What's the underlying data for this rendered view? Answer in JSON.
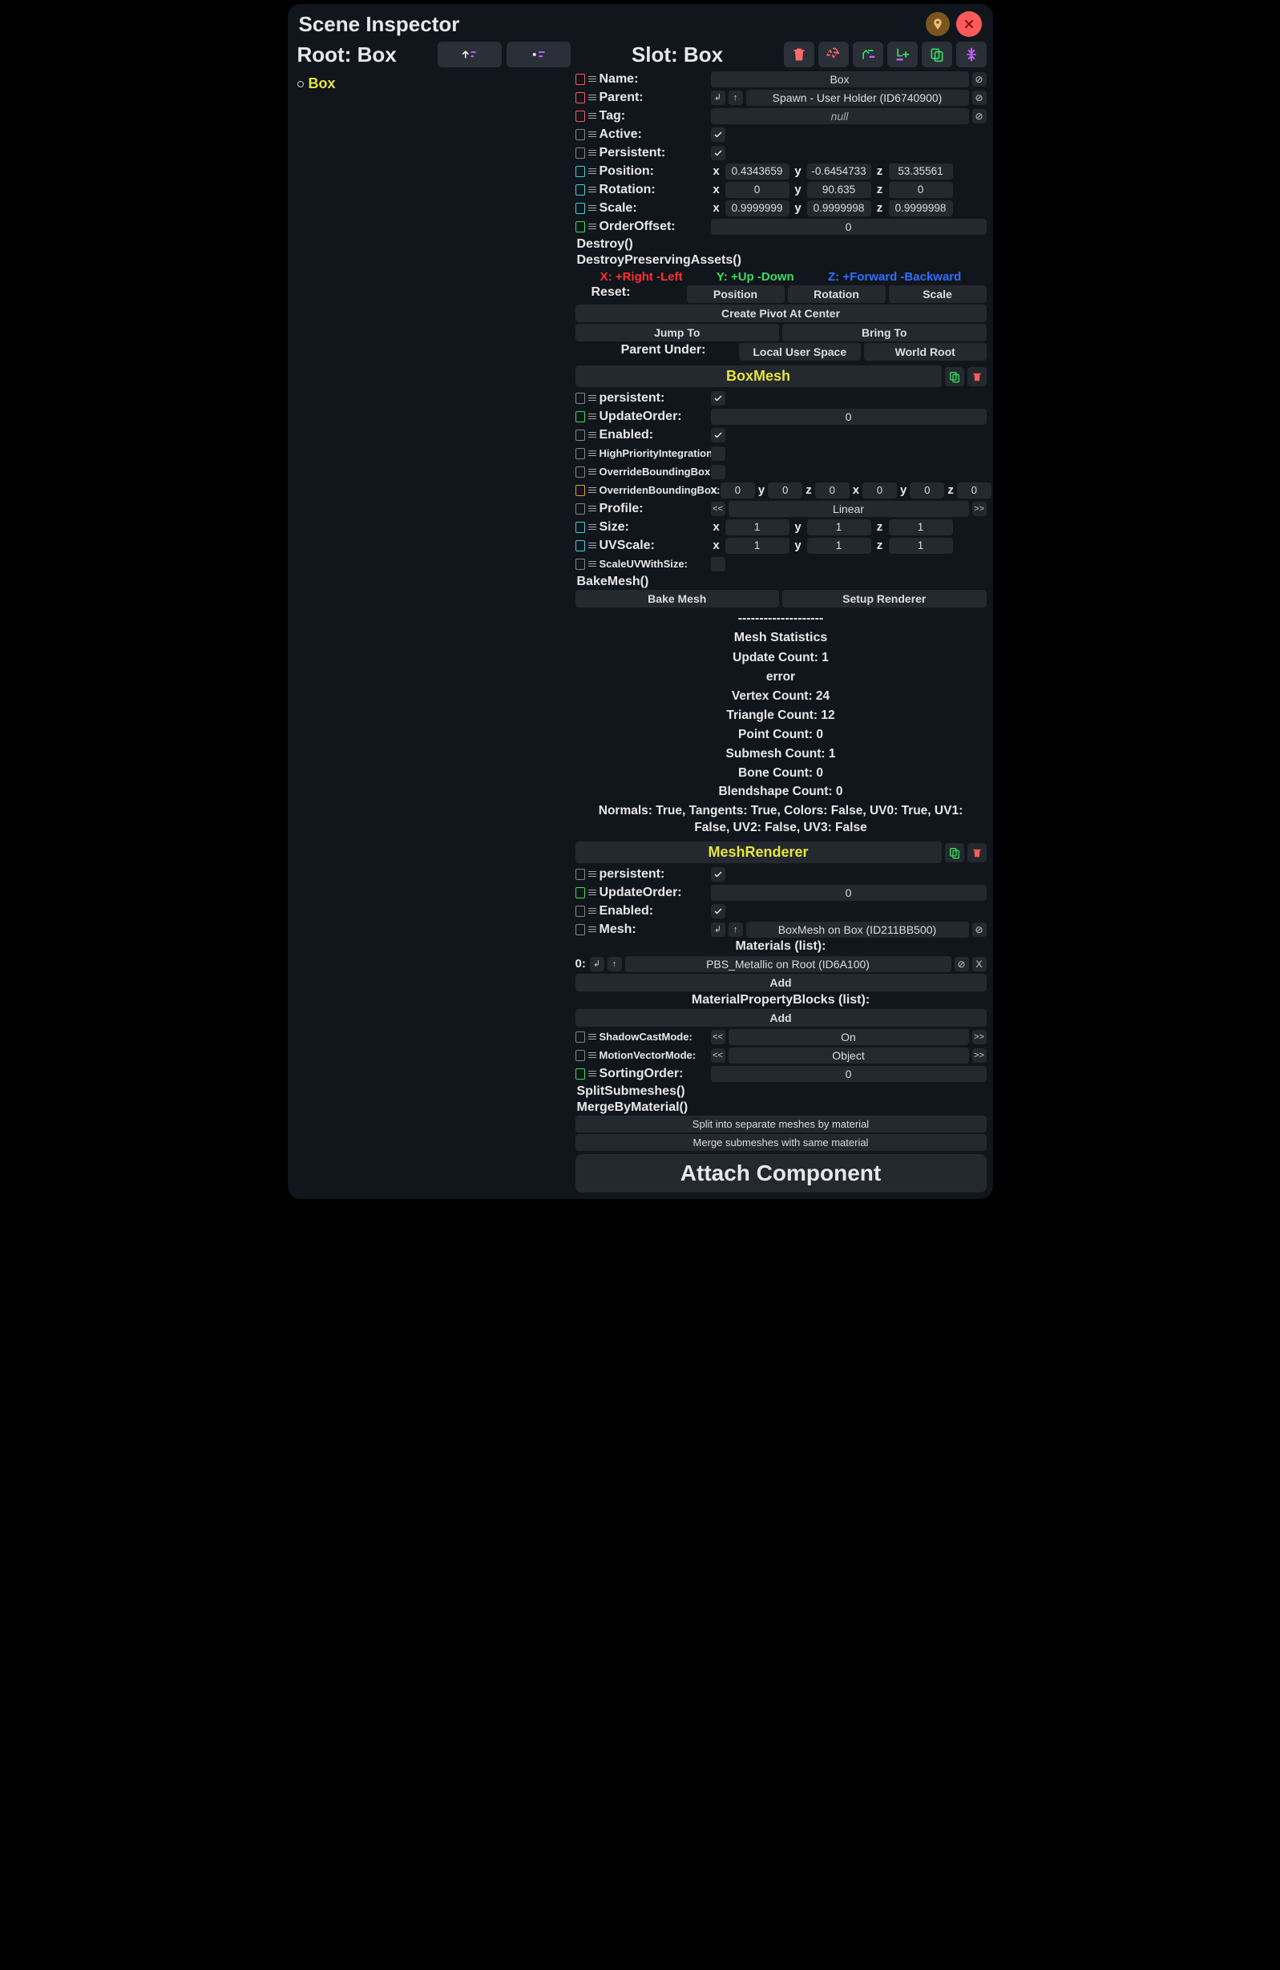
{
  "title": "Scene Inspector",
  "root": {
    "label": "Root: Box",
    "tree_item": "Box"
  },
  "slot": {
    "title": "Slot: Box"
  },
  "fields": {
    "name": {
      "label": "Name:",
      "value": "Box"
    },
    "parent": {
      "label": "Parent:",
      "value": "Spawn - User Holder (ID6740900)"
    },
    "tag": {
      "label": "Tag:",
      "value": "null"
    },
    "active": {
      "label": "Active:",
      "checked": true
    },
    "persistent": {
      "label": "Persistent:",
      "checked": true
    },
    "position": {
      "label": "Position:",
      "x": "0.4343659",
      "y": "-0.6454733",
      "z": "53.35561"
    },
    "rotation": {
      "label": "Rotation:",
      "x": "0",
      "y": "90.635",
      "z": "0"
    },
    "scale": {
      "label": "Scale:",
      "x": "0.9999999",
      "y": "0.9999998",
      "z": "0.9999998"
    },
    "orderoffset": {
      "label": "OrderOffset:",
      "value": "0"
    }
  },
  "funcs": {
    "destroy": "Destroy()",
    "destroypa": "DestroyPreservingAssets()"
  },
  "axishint": {
    "x": "X: +Right -Left",
    "y": "Y: +Up -Down",
    "z": "Z: +Forward -Backward"
  },
  "reset": {
    "label": "Reset:",
    "pos": "Position",
    "rot": "Rotation",
    "scl": "Scale"
  },
  "createpivot": "Create Pivot At Center",
  "jumpto": "Jump To",
  "bringto": "Bring To",
  "parentunder": {
    "label": "Parent Under:",
    "local": "Local User Space",
    "world": "World Root"
  },
  "boxmesh": {
    "title": "BoxMesh",
    "persistent": {
      "label": "persistent:",
      "checked": true
    },
    "updateorder": {
      "label": "UpdateOrder:",
      "value": "0"
    },
    "enabled": {
      "label": "Enabled:",
      "checked": true
    },
    "hpi": {
      "label": "HighPriorityIntegration:"
    },
    "obb": {
      "label": "OverrideBoundingBox:"
    },
    "obbb": {
      "label": "OverridenBoundingBox:",
      "x1": "0",
      "y1": "0",
      "z1": "0",
      "x2": "0",
      "y2": "0",
      "z2": "0"
    },
    "profile": {
      "label": "Profile:",
      "value": "Linear"
    },
    "size": {
      "label": "Size:",
      "x": "1",
      "y": "1",
      "z": "1"
    },
    "uvscale": {
      "label": "UVScale:",
      "x": "1",
      "y": "1",
      "z": "1"
    },
    "scaleuv": {
      "label": "ScaleUVWithSize:"
    },
    "bakefn": "BakeMesh()",
    "bakebtn": "Bake Mesh",
    "setuprend": "Setup Renderer",
    "divider": "--------------------",
    "stats_h": "Mesh Statistics",
    "updcnt": "Update Count: 1",
    "err": "error",
    "vcnt": "Vertex Count: 24",
    "tcnt": "Triangle Count: 12",
    "pcnt": "Point Count: 0",
    "scnt": "Submesh Count: 1",
    "bcnt": "Bone Count: 0",
    "bscnt": "Blendshape Count: 0",
    "norms": "Normals: True, Tangents: True, Colors: False, UV0: True, UV1: False, UV2: False, UV3: False"
  },
  "meshrend": {
    "title": "MeshRenderer",
    "persistent": {
      "label": "persistent:",
      "checked": true
    },
    "updateorder": {
      "label": "UpdateOrder:",
      "value": "0"
    },
    "enabled": {
      "label": "Enabled:",
      "checked": true
    },
    "mesh": {
      "label": "Mesh:",
      "value": "BoxMesh on Box (ID211BB500)"
    },
    "mats_h": "Materials (list):",
    "mat0_idx": "0:",
    "mat0_val": "PBS_Metallic on Root (ID6A100)",
    "add": "Add",
    "mpb_h": "MaterialPropertyBlocks (list):",
    "shadowcast": {
      "label": "ShadowCastMode:",
      "value": "On"
    },
    "mvmode": {
      "label": "MotionVectorMode:",
      "value": "Object"
    },
    "sortorder": {
      "label": "SortingOrder:",
      "value": "0"
    },
    "splitfn": "SplitSubmeshes()",
    "mergefn": "MergeByMaterial()",
    "splitbtn": "Split into separate meshes by material",
    "mergebtn": "Merge submeshes with same material"
  },
  "attach": "Attach Component"
}
